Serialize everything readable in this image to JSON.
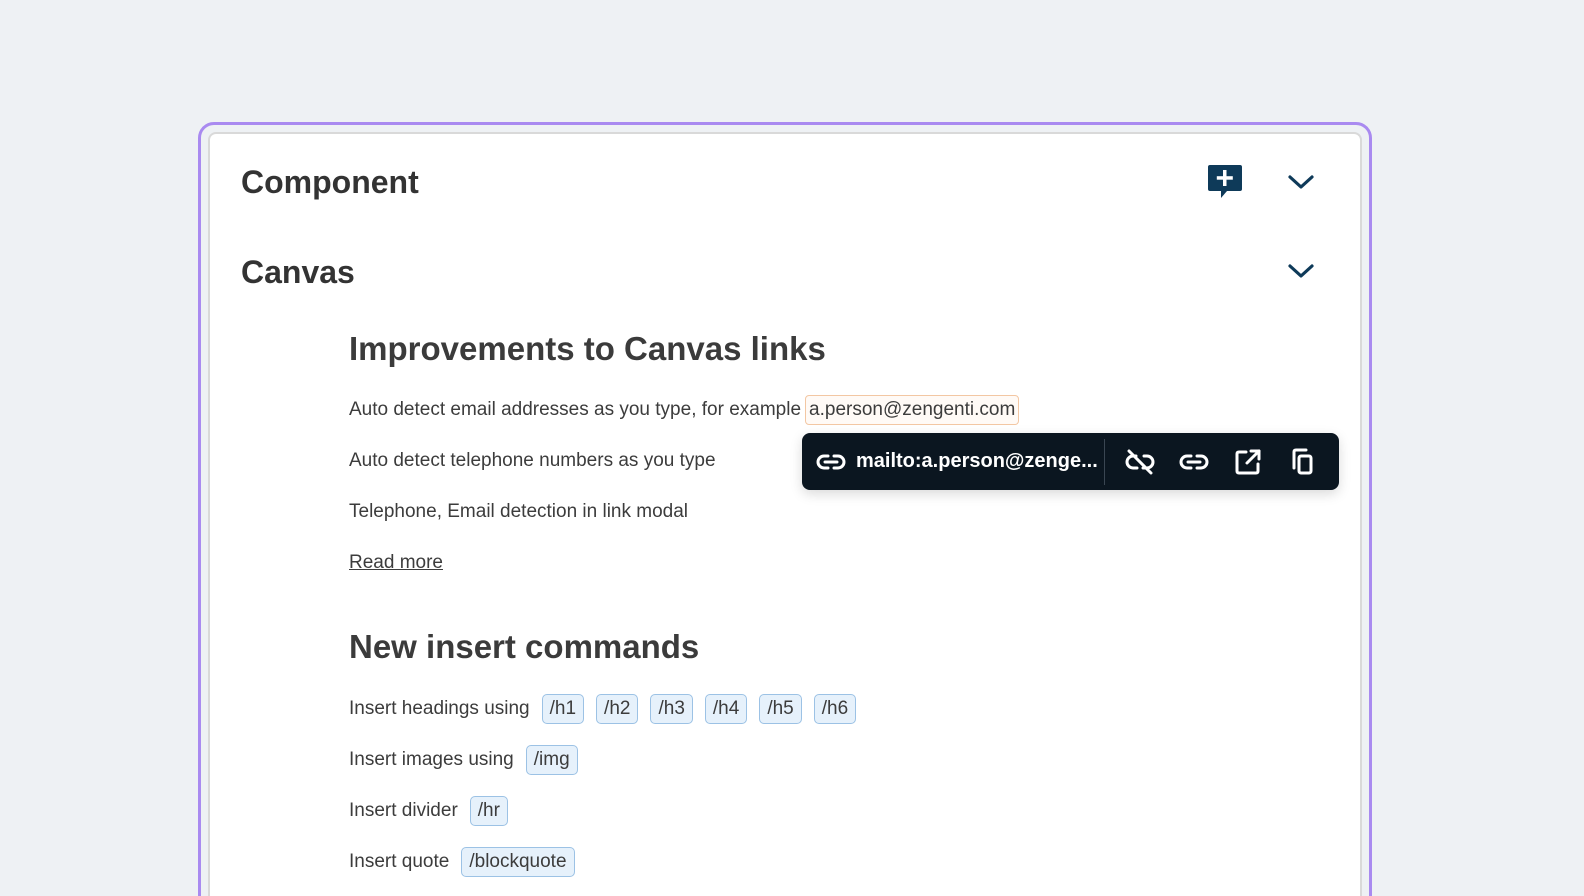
{
  "sections": {
    "component": {
      "title": "Component"
    },
    "canvas": {
      "title": "Canvas"
    }
  },
  "links_section": {
    "heading": "Improvements to Canvas links",
    "email_text": "Auto detect email addresses as you type, for example",
    "email_value": "a.person@zengenti.com",
    "phone_text": "Auto detect telephone numbers as you type",
    "modal_text": "Telephone, Email detection in link modal",
    "read_more": "Read more"
  },
  "insert_section": {
    "heading": "New insert commands",
    "headings_label": "Insert headings using",
    "heading_tags": [
      "/h1",
      "/h2",
      "/h3",
      "/h4",
      "/h5",
      "/h6"
    ],
    "images_label": "Insert images using",
    "images_tag": "/img",
    "divider_label": "Insert divider",
    "divider_tag": "/hr",
    "quote_label": "Insert quote",
    "quote_tag": "/blockquote"
  },
  "link_popover": {
    "url": "mailto:a.person@zenge...",
    "icons": [
      "link-icon",
      "unlink-icon",
      "edit-link-icon",
      "open-external-icon",
      "copy-icon"
    ]
  },
  "colors": {
    "accent_border": "#a98af0",
    "popover_bg": "#0b1620",
    "tag_bg": "#e6f1fb",
    "tag_border": "#9cc2e5",
    "email_chip_border": "#f3c7a3",
    "icon_navy": "#0e3a59"
  }
}
